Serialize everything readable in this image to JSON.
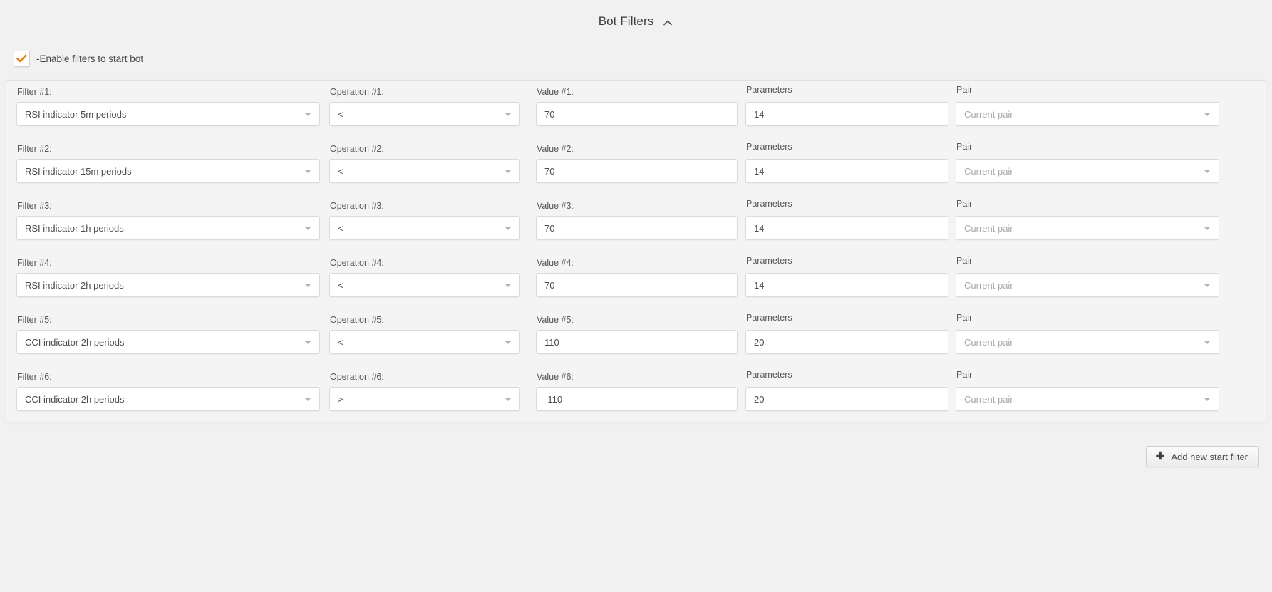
{
  "header": {
    "title": "Bot Filters",
    "collapse_icon": "chevron-up-icon"
  },
  "enable": {
    "label": "-Enable filters to start bot",
    "checked": true,
    "check_color": "#e8811f"
  },
  "columns": {
    "filter": "Filter",
    "operation": "Operation",
    "value": "Value",
    "parameters": "Parameters",
    "pair": "Pair"
  },
  "rows": [
    {
      "filter_label": "Filter #1:",
      "filter_value": "RSI indicator 5m periods",
      "operation_label": "Operation #1:",
      "operation_value": "<",
      "value_label": "Value #1:",
      "value_value": "70",
      "parameters_label": "Parameters",
      "parameters_value": "14",
      "pair_label": "Pair",
      "pair_placeholder": "Current pair"
    },
    {
      "filter_label": "Filter #2:",
      "filter_value": "RSI indicator 15m periods",
      "operation_label": "Operation #2:",
      "operation_value": "<",
      "value_label": "Value #2:",
      "value_value": "70",
      "parameters_label": "Parameters",
      "parameters_value": "14",
      "pair_label": "Pair",
      "pair_placeholder": "Current pair"
    },
    {
      "filter_label": "Filter #3:",
      "filter_value": "RSI indicator 1h periods",
      "operation_label": "Operation #3:",
      "operation_value": "<",
      "value_label": "Value #3:",
      "value_value": "70",
      "parameters_label": "Parameters",
      "parameters_value": "14",
      "pair_label": "Pair",
      "pair_placeholder": "Current pair"
    },
    {
      "filter_label": "Filter #4:",
      "filter_value": "RSI indicator 2h periods",
      "operation_label": "Operation #4:",
      "operation_value": "<",
      "value_label": "Value #4:",
      "value_value": "70",
      "parameters_label": "Parameters",
      "parameters_value": "14",
      "pair_label": "Pair",
      "pair_placeholder": "Current pair"
    },
    {
      "filter_label": "Filter #5:",
      "filter_value": "CCI indicator 2h periods",
      "operation_label": "Operation #5:",
      "operation_value": "<",
      "value_label": "Value #5:",
      "value_value": "110",
      "parameters_label": "Parameters",
      "parameters_value": "20",
      "pair_label": "Pair",
      "pair_placeholder": "Current pair"
    },
    {
      "filter_label": "Filter #6:",
      "filter_value": "CCI indicator 2h periods",
      "operation_label": "Operation #6:",
      "operation_value": ">",
      "value_label": "Value #6:",
      "value_value": "-110",
      "parameters_label": "Parameters",
      "parameters_value": "20",
      "pair_label": "Pair",
      "pair_placeholder": "Current pair"
    }
  ],
  "footer": {
    "add_filter_label": "Add new start filter",
    "add_filter_icon": "plus-icon"
  }
}
